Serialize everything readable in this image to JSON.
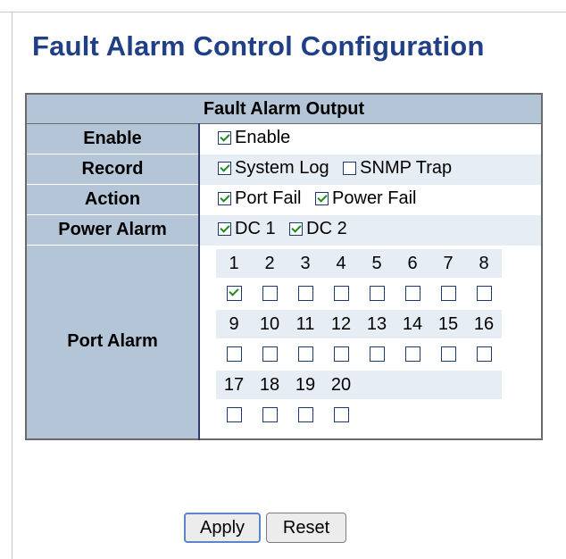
{
  "page": {
    "title": "Fault Alarm Control Configuration"
  },
  "table": {
    "header": "Fault Alarm Output"
  },
  "rows": {
    "enable": {
      "label": "Enable",
      "option": {
        "label": "Enable",
        "checked": true
      }
    },
    "record": {
      "label": "Record",
      "options": [
        {
          "label": "System Log",
          "checked": true
        },
        {
          "label": "SNMP Trap",
          "checked": false
        }
      ]
    },
    "action": {
      "label": "Action",
      "options": [
        {
          "label": "Port Fail",
          "checked": true
        },
        {
          "label": "Power Fail",
          "checked": true
        }
      ]
    },
    "power_alarm": {
      "label": "Power Alarm",
      "options": [
        {
          "label": "DC 1",
          "checked": true
        },
        {
          "label": "DC 2",
          "checked": true
        }
      ]
    },
    "port_alarm": {
      "label": "Port Alarm",
      "ports": [
        {
          "n": "1",
          "checked": true
        },
        {
          "n": "2",
          "checked": false
        },
        {
          "n": "3",
          "checked": false
        },
        {
          "n": "4",
          "checked": false
        },
        {
          "n": "5",
          "checked": false
        },
        {
          "n": "6",
          "checked": false
        },
        {
          "n": "7",
          "checked": false
        },
        {
          "n": "8",
          "checked": false
        },
        {
          "n": "9",
          "checked": false
        },
        {
          "n": "10",
          "checked": false
        },
        {
          "n": "11",
          "checked": false
        },
        {
          "n": "12",
          "checked": false
        },
        {
          "n": "13",
          "checked": false
        },
        {
          "n": "14",
          "checked": false
        },
        {
          "n": "15",
          "checked": false
        },
        {
          "n": "16",
          "checked": false
        },
        {
          "n": "17",
          "checked": false
        },
        {
          "n": "18",
          "checked": false
        },
        {
          "n": "19",
          "checked": false
        },
        {
          "n": "20",
          "checked": false
        }
      ]
    }
  },
  "buttons": {
    "apply": "Apply",
    "reset": "Reset"
  }
}
